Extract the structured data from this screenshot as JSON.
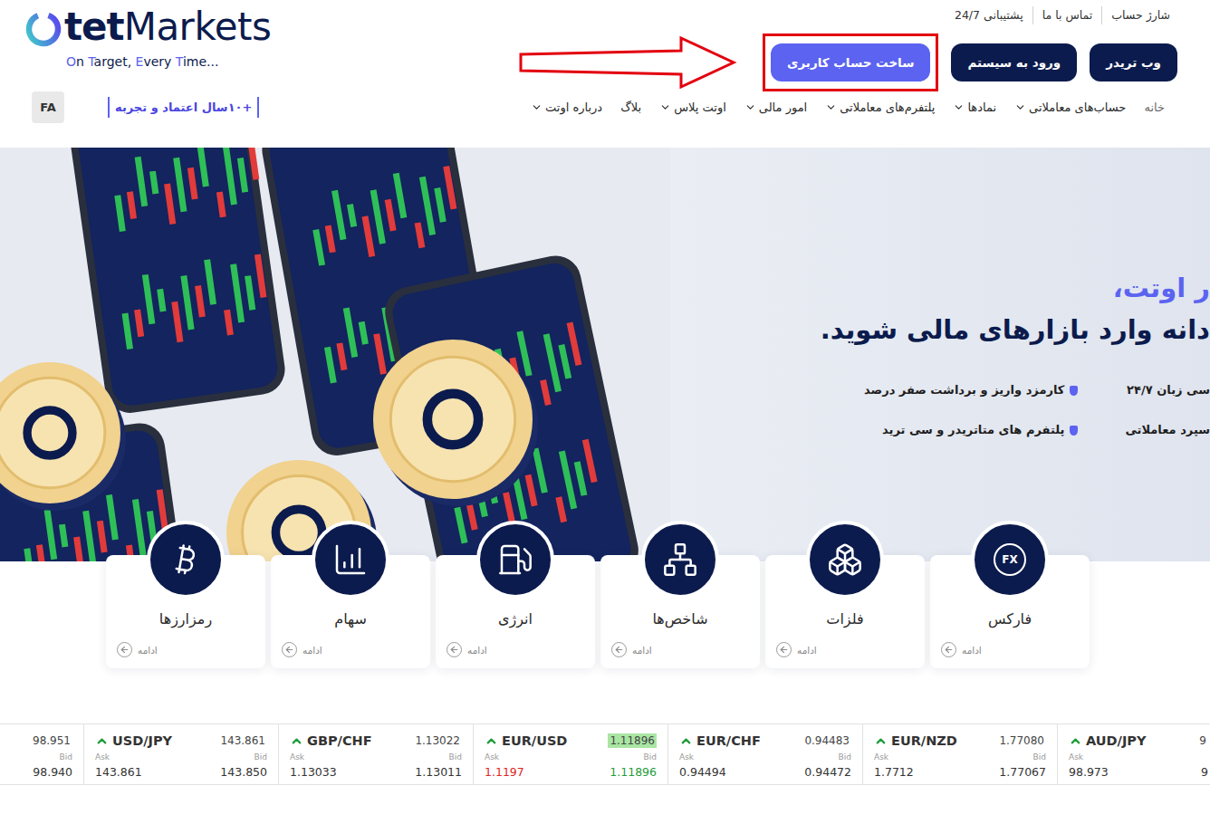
{
  "header": {
    "logo": {
      "brand": "tet",
      "product": "Markets",
      "tagline": [
        {
          "text": "O",
          "accent": true
        },
        {
          "text": "n ",
          "accent": false
        },
        {
          "text": "T",
          "accent": true
        },
        {
          "text": "arget, ",
          "accent": false
        },
        {
          "text": "E",
          "accent": true
        },
        {
          "text": "very ",
          "accent": false
        },
        {
          "text": "T",
          "accent": true
        },
        {
          "text": "ime...",
          "accent": false
        }
      ]
    },
    "top_links": [
      "شارژ حساب",
      "تماس با ما",
      "پشتیبانی 24/7"
    ],
    "buttons": [
      {
        "label": "وب تریدر",
        "kind": "dark",
        "highlighted": false
      },
      {
        "label": "ورود به سیستم",
        "kind": "dark",
        "highlighted": false
      },
      {
        "label": "ساخت حساب کاربری",
        "kind": "primary",
        "highlighted": true
      }
    ],
    "nav": [
      {
        "label": "خانه",
        "has_menu": false,
        "selected": true
      },
      {
        "label": "حساب‌های معاملاتی",
        "has_menu": true,
        "selected": false
      },
      {
        "label": "نمادها",
        "has_menu": true,
        "selected": false
      },
      {
        "label": "پلتفرم‌های معاملاتی",
        "has_menu": true,
        "selected": false
      },
      {
        "label": "امور مالی",
        "has_menu": true,
        "selected": false
      },
      {
        "label": "اوتت پلاس",
        "has_menu": true,
        "selected": false
      },
      {
        "label": "بلاگ",
        "has_menu": false,
        "selected": false
      },
      {
        "label": "درباره اوتت",
        "has_menu": true,
        "selected": false
      }
    ],
    "badge": "+۱۰سال اعتماد و تجربه",
    "language": "FA"
  },
  "hero": {
    "title_accent": "ر اوتت،",
    "title": "دانه وارد بازارهای مالی شوید.",
    "features": [
      {
        "text": "سی زبان ۲۴/۷",
        "bullet": false
      },
      {
        "text": "کارمزد واریز و برداشت صفر درصد",
        "bullet": true
      },
      {
        "text": "سپرد معاملاتی",
        "bullet": false
      },
      {
        "text": "پلتفرم های متاتریدر و سی ترید",
        "bullet": true
      }
    ]
  },
  "categories": [
    {
      "label": "فارکس",
      "kind": "fx",
      "icon_text": "FX",
      "more": "ادامه"
    },
    {
      "label": "فلزات",
      "kind": "metals",
      "more": "ادامه"
    },
    {
      "label": "شاخص‌ها",
      "kind": "indices",
      "more": "ادامه"
    },
    {
      "label": "انرژی",
      "kind": "energy",
      "more": "ادامه"
    },
    {
      "label": "سهام",
      "kind": "stocks",
      "more": "ادامه"
    },
    {
      "label": "رمزارزها",
      "kind": "crypto",
      "more": "ادامه"
    }
  ],
  "ticker": [
    {
      "kind": "partial-left",
      "top": "98.951",
      "bid_label": "Bid",
      "bid": "98.940",
      "top_state": "none",
      "bid_state": "none"
    },
    {
      "kind": "full",
      "name": "USD/JPY",
      "trend": "up",
      "top": "143.861",
      "ask_label": "Ask",
      "bid_label": "Bid",
      "ask": "143.861",
      "bid": "143.850",
      "top_state": "none",
      "ask_state": "none",
      "bid_state": "none"
    },
    {
      "kind": "full",
      "name": "GBP/CHF",
      "trend": "up",
      "top": "1.13022",
      "ask_label": "Ask",
      "bid_label": "Bid",
      "ask": "1.13033",
      "bid": "1.13011",
      "top_state": "none",
      "ask_state": "none",
      "bid_state": "none"
    },
    {
      "kind": "full",
      "name": "EUR/USD",
      "trend": "up",
      "top": "1.11896",
      "ask_label": "Ask",
      "bid_label": "Bid",
      "ask": "1.1197",
      "bid": "1.11896",
      "top_state": "up",
      "ask_state": "down",
      "bid_state": "up"
    },
    {
      "kind": "full",
      "name": "EUR/CHF",
      "trend": "up",
      "top": "0.94483",
      "ask_label": "Ask",
      "bid_label": "Bid",
      "ask": "0.94494",
      "bid": "0.94472",
      "top_state": "none",
      "ask_state": "none",
      "bid_state": "none"
    },
    {
      "kind": "full",
      "name": "EUR/NZD",
      "trend": "up",
      "top": "1.77080",
      "ask_label": "Ask",
      "bid_label": "Bid",
      "ask": "1.7712",
      "bid": "1.77067",
      "top_state": "none",
      "ask_state": "none",
      "bid_state": "none"
    },
    {
      "kind": "partial-right",
      "name": "AUD/JPY",
      "trend": "up",
      "top": "9",
      "ask_label": "Ask",
      "ask": "98.973",
      "bid": "9",
      "top_state": "none",
      "ask_state": "none",
      "bid_state": "none"
    }
  ]
}
